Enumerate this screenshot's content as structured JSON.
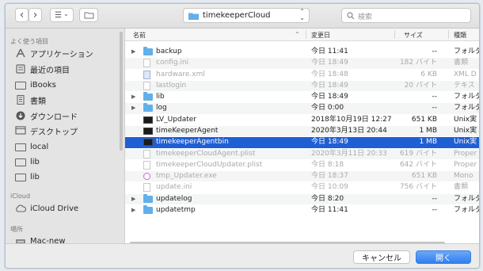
{
  "toolbar": {
    "back_glyph": "‹",
    "forward_glyph": "›",
    "view_glyph": "☰",
    "view_arrow": "⌄",
    "newfolder_icon": "folder-outline-icon",
    "location": "timekeeperCloud",
    "location_arrows": "⌃⌄",
    "search_placeholder": "検索"
  },
  "sidebar": {
    "favorites_header": "よく使う項目",
    "favorites": [
      {
        "label": "アプリケーション",
        "icon": "applications-icon"
      },
      {
        "label": "最近の項目",
        "icon": "recents-icon"
      },
      {
        "label": "iBooks",
        "icon": "folder-icon"
      },
      {
        "label": "書類",
        "icon": "documents-icon"
      },
      {
        "label": "ダウンロード",
        "icon": "downloads-icon"
      },
      {
        "label": "デスクトップ",
        "icon": "desktop-icon"
      },
      {
        "label": "local",
        "icon": "folder-icon"
      },
      {
        "label": "lib",
        "icon": "folder-icon"
      },
      {
        "label": "lib",
        "icon": "folder-icon"
      }
    ],
    "icloud_header": "iCloud",
    "icloud_item": "iCloud Drive",
    "places_header": "場所",
    "places_item": "Mac-new"
  },
  "columns": {
    "name": "名前",
    "date": "変更日",
    "size": "サイズ",
    "kind": "種類",
    "sort_indicator": "⌃"
  },
  "files": [
    {
      "name": "backup",
      "date": "今日 11:41",
      "size": "--",
      "kind": "フォルダ",
      "type": "folder",
      "dim": false,
      "expand": true
    },
    {
      "name": "config.ini",
      "date": "今日 18:49",
      "size": "182 バイト",
      "kind": "書類",
      "type": "doc",
      "dim": true,
      "expand": false
    },
    {
      "name": "hardware.xml",
      "date": "今日 18:48",
      "size": "6 KB",
      "kind": "XML D",
      "type": "img",
      "dim": true,
      "expand": false
    },
    {
      "name": "lastlogin",
      "date": "今日 18:49",
      "size": "20 バイト",
      "kind": "テキス",
      "type": "doc",
      "dim": true,
      "expand": false
    },
    {
      "name": "lib",
      "date": "今日 18:49",
      "size": "--",
      "kind": "フォルダ",
      "type": "folder",
      "dim": false,
      "expand": true
    },
    {
      "name": "log",
      "date": "今日 0:00",
      "size": "--",
      "kind": "フォルダ",
      "type": "folder",
      "dim": false,
      "expand": true
    },
    {
      "name": "LV_Updater",
      "date": "2018年10月19日 12:27",
      "size": "651 KB",
      "kind": "Unix実",
      "type": "exe",
      "dim": false,
      "expand": false
    },
    {
      "name": "timeKeeperAgent",
      "date": "2020年3月13日 20:44",
      "size": "1 MB",
      "kind": "Unix実",
      "type": "exe",
      "dim": false,
      "expand": false
    },
    {
      "name": "timekeeperAgentbin",
      "date": "今日 18:49",
      "size": "1 MB",
      "kind": "Unix実",
      "type": "exe",
      "dim": false,
      "expand": false,
      "selected": true
    },
    {
      "name": "timekeeperCloudAgent.plist",
      "date": "2020年3月11日 20:33",
      "size": "619 バイト",
      "kind": "Proper",
      "type": "doc",
      "dim": true,
      "expand": false
    },
    {
      "name": "timekeeperCloudUpdater.plist",
      "date": "今日 8:18",
      "size": "642 バイト",
      "kind": "Proper",
      "type": "doc",
      "dim": true,
      "expand": false
    },
    {
      "name": "tmp_Updater.exe",
      "date": "今日 18:37",
      "size": "651 KB",
      "kind": "Mono",
      "type": "exeapp",
      "dim": true,
      "expand": false
    },
    {
      "name": "update.ini",
      "date": "今日 10:09",
      "size": "756 バイト",
      "kind": "書類",
      "type": "doc",
      "dim": true,
      "expand": false
    },
    {
      "name": "updatelog",
      "date": "今日 8:20",
      "size": "--",
      "kind": "フォルダ",
      "type": "folder",
      "dim": false,
      "expand": true
    },
    {
      "name": "updatetmp",
      "date": "今日 11:41",
      "size": "--",
      "kind": "フォルダ",
      "type": "folder",
      "dim": false,
      "expand": true
    }
  ],
  "buttons": {
    "cancel": "キャンセル",
    "open": "開く"
  },
  "colors": {
    "selection": "#1f5fd4",
    "folder": "#62b0ea",
    "accent": "#2f7ef0"
  }
}
